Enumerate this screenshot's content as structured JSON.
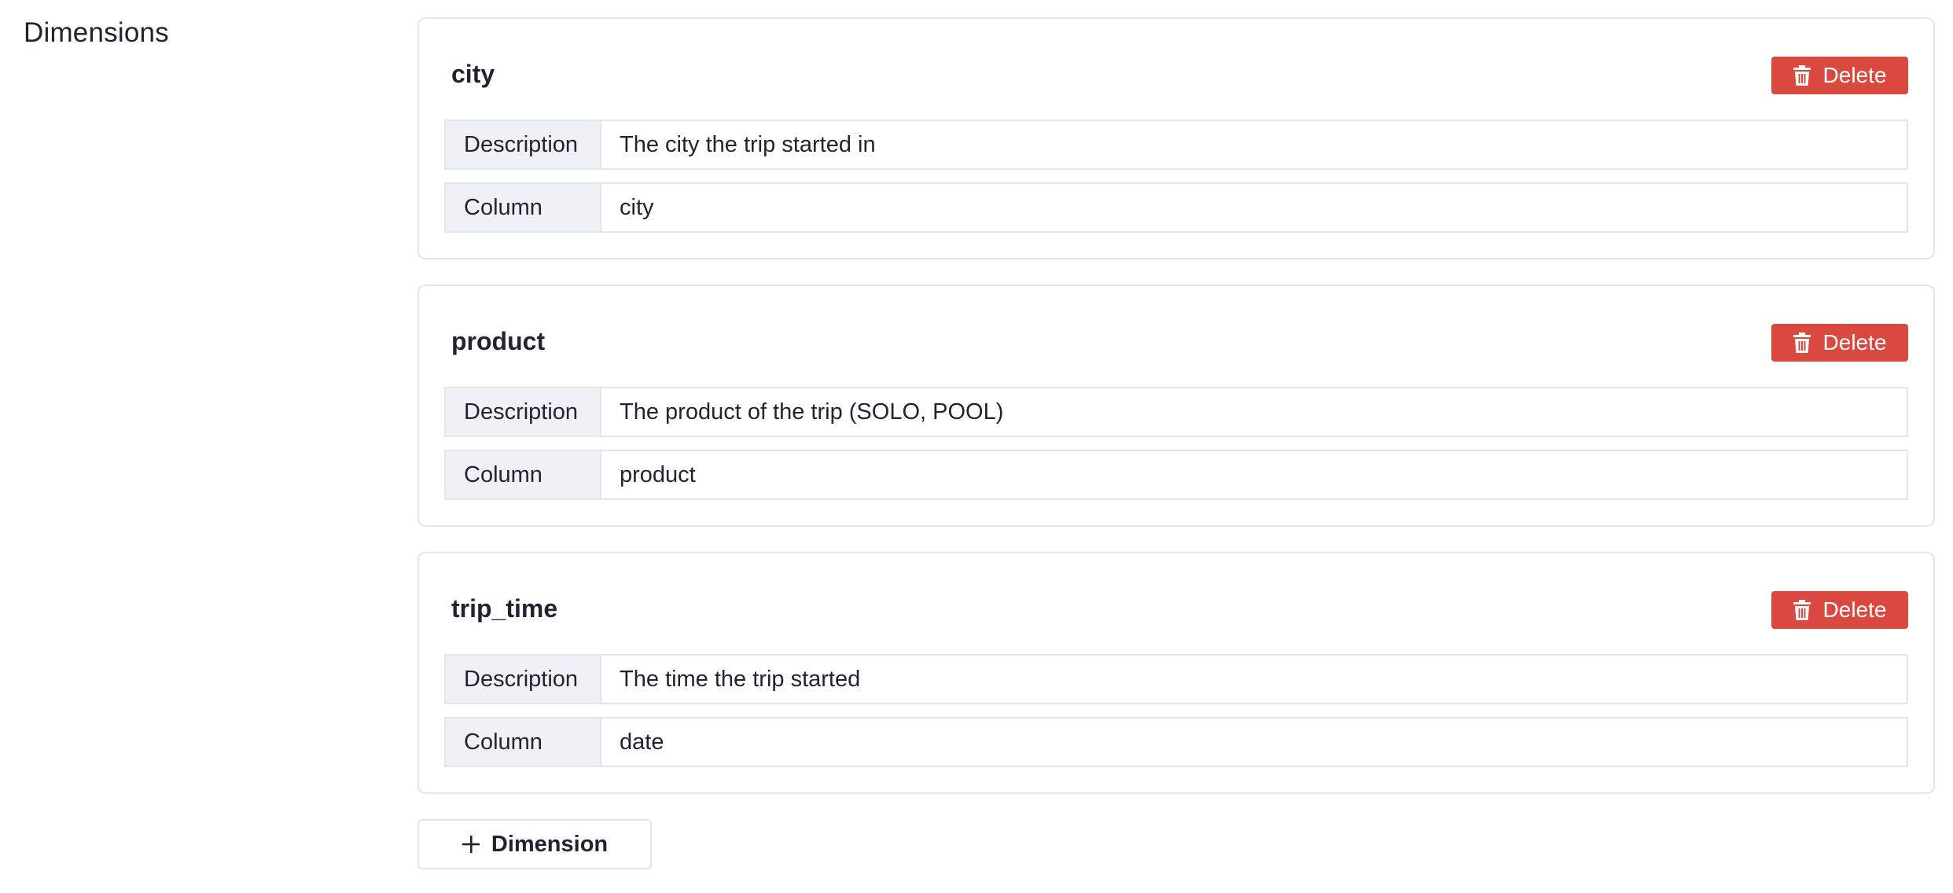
{
  "section": {
    "title": "Dimensions"
  },
  "dimensions": [
    {
      "name": "city",
      "delete_label": "Delete",
      "description_label": "Description",
      "description": "The city the trip started in",
      "column_label": "Column",
      "column": "city"
    },
    {
      "name": "product",
      "delete_label": "Delete",
      "description_label": "Description",
      "description": "The product of the trip (SOLO, POOL)",
      "column_label": "Column",
      "column": "product"
    },
    {
      "name": "trip_time",
      "delete_label": "Delete",
      "description_label": "Description",
      "description": "The time the trip started",
      "column_label": "Column",
      "column": "date"
    }
  ],
  "add_button": {
    "label": "Dimension",
    "icon": "plus-icon"
  },
  "icons": {
    "delete": "trash-icon"
  },
  "colors": {
    "delete_button": "#d9493f",
    "label_background": "#eef1f5",
    "border": "#e3e6ea",
    "text": "#1f2430"
  }
}
